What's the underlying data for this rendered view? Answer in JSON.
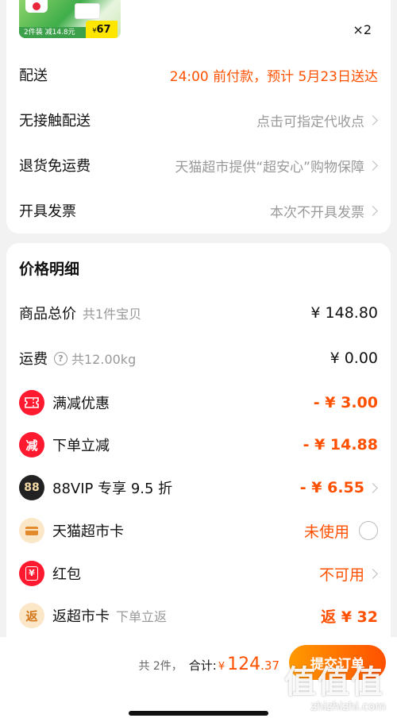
{
  "product": {
    "thumb_bar_text": "2件装 减14.8元",
    "thumb_price_small": "¥",
    "thumb_price": "67",
    "quantity": "×2"
  },
  "delivery": {
    "rows": [
      {
        "label": "配送",
        "value": "24:00 前付款，预计 5月23日送达"
      },
      {
        "label": "无接触配送",
        "value": "点击可指定代收点"
      },
      {
        "label": "退货免运费",
        "value": "天猫超市提供“超安心”购物保障"
      },
      {
        "label": "开具发票",
        "value": "本次不开具发票"
      }
    ]
  },
  "price_detail": {
    "title": "价格明细",
    "rows": [
      {
        "label": "商品总价",
        "sub": "共1件宝贝",
        "value": "¥ 148.80"
      },
      {
        "label": "运费",
        "sub": "共12.00kg",
        "value": "¥ 0.00"
      },
      {
        "label": "满减优惠",
        "value": "- ¥ 3.00",
        "icon": "ticket-icon"
      },
      {
        "label": "下单立减",
        "value": "- ¥ 14.88",
        "icon": "discount-tag-icon",
        "icon_text": "减"
      },
      {
        "label": "88VIP 专享 9.5 折",
        "value": "- ¥ 6.55",
        "icon": "vip88-icon",
        "icon_text": "88"
      },
      {
        "label": "天猫超市卡",
        "value": "未使用",
        "icon": "supermarket-card-icon"
      },
      {
        "label": "红包",
        "value": "不可用",
        "icon": "red-packet-icon",
        "icon_text": "¥"
      },
      {
        "label": "返超市卡",
        "sub": "下单立返",
        "value": "返 ¥ 32",
        "icon": "cashback-icon",
        "icon_text": "返"
      }
    ]
  },
  "bottom": {
    "count": "共 2件，",
    "total_label": "合计:",
    "currency": "¥",
    "total_int": "124",
    "total_dec": ".37",
    "submit_label": "提交订单"
  },
  "watermark": {
    "text": "值值值",
    "url": "zhizhizhi.com"
  },
  "colors": {
    "accent": "#ff5000",
    "red_icon": "#ff1a30"
  }
}
